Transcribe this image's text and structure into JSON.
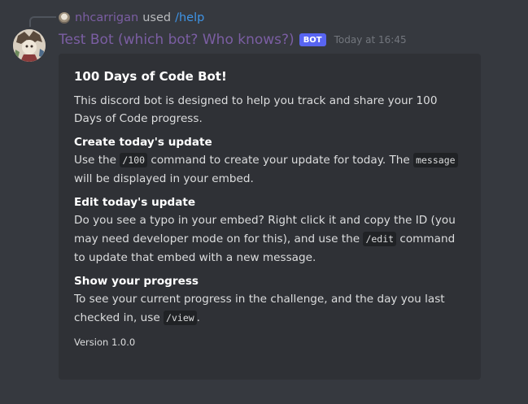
{
  "reply": {
    "username": "nhcarrigan",
    "used_text": "used",
    "command": "/help"
  },
  "author": {
    "name": "Test Bot (which bot? Who knows?)",
    "tag": "BOT",
    "timestamp": "Today at 16:45"
  },
  "embed": {
    "title": "100 Days of Code Bot!",
    "description": "This discord bot is designed to help you track and share your 100 Days of Code progress.",
    "fields": [
      {
        "name": "Create today's update",
        "parts": [
          "Use the ",
          "/100",
          " command to create your update for today. The ",
          "message",
          " will be displayed in your embed."
        ]
      },
      {
        "name": "Edit today's update",
        "parts": [
          "Do you see a typo in your embed? Right click it and copy the ID (you may need developer mode on for this), and use the ",
          "/edit",
          " command to update that embed with a new message."
        ]
      },
      {
        "name": "Show your progress",
        "parts": [
          "To see your current progress in the challenge, and the day you last checked in, use ",
          "/view",
          "."
        ]
      }
    ],
    "footer": "Version 1.0.0"
  },
  "colors": {
    "background": "#36393f",
    "embed_background": "#2f3136",
    "username": "#7b5ea3",
    "command_link": "#3f94e6",
    "bot_tag": "#5865f2"
  },
  "icons": {
    "reply_avatar": "user-avatar-icon",
    "bot_avatar": "bot-avatar-image"
  }
}
